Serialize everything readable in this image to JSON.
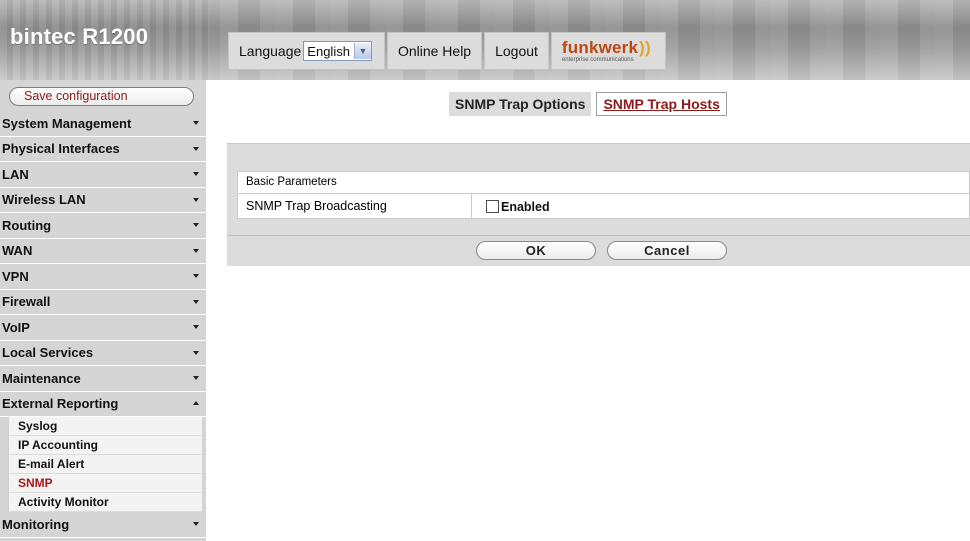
{
  "header": {
    "brand": "bintec R1200",
    "language_label": "Language",
    "language_value": "English",
    "online_help": "Online Help",
    "logout": "Logout",
    "logo_text": "funkwerk",
    "logo_subtext": "enterprise communications"
  },
  "sidebar": {
    "save_label": "Save configuration",
    "items": [
      {
        "label": "System Management"
      },
      {
        "label": "Physical Interfaces"
      },
      {
        "label": "LAN"
      },
      {
        "label": "Wireless LAN"
      },
      {
        "label": "Routing"
      },
      {
        "label": "WAN"
      },
      {
        "label": "VPN"
      },
      {
        "label": "Firewall"
      },
      {
        "label": "VoIP"
      },
      {
        "label": "Local Services"
      },
      {
        "label": "Maintenance"
      },
      {
        "label": "External Reporting"
      }
    ],
    "subitems": [
      "Syslog",
      "IP Accounting",
      "E-mail Alert",
      "SNMP",
      "Activity Monitor"
    ],
    "after": {
      "label": "Monitoring"
    }
  },
  "tabs": {
    "active": "SNMP Trap Options",
    "link": "SNMP Trap Hosts"
  },
  "form": {
    "section": "Basic Parameters",
    "row_label": "SNMP Trap Broadcasting",
    "checkbox_label": "Enabled",
    "checkbox_checked": false
  },
  "buttons": {
    "ok": "OK",
    "cancel": "Cancel"
  },
  "colors": {
    "accent_red": "#8b1a1a",
    "sidebar_bg": "#d5d5d5",
    "panel_bg": "#dcdcdc"
  }
}
